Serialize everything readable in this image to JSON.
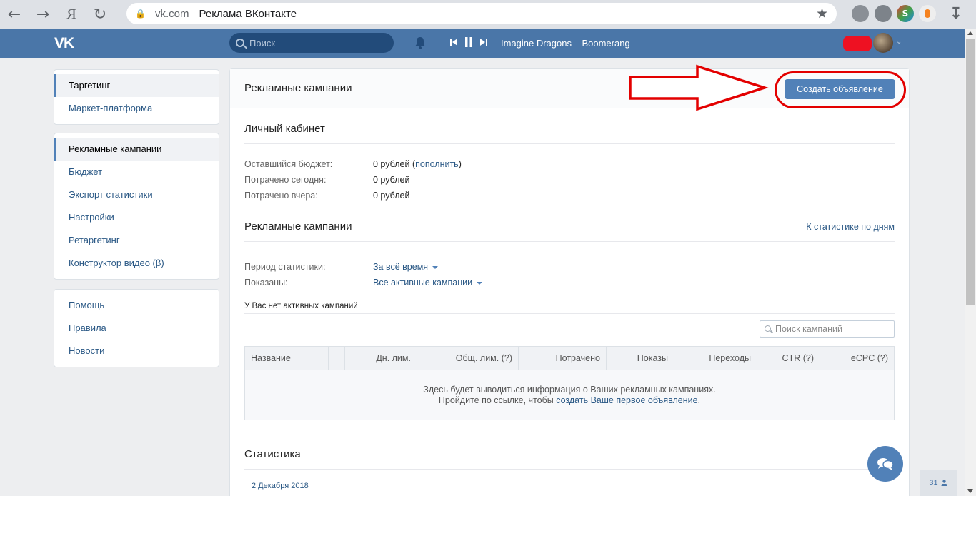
{
  "browser": {
    "url": "vk.com",
    "page_title": "Реклама ВКонтакте"
  },
  "vk": {
    "logo": "VK",
    "search_placeholder": "Поиск",
    "now_playing": "Imagine Dragons – Boomerang"
  },
  "sidebar": {
    "group1": [
      "Таргетинг",
      "Маркет-платформа"
    ],
    "group2": [
      "Рекламные кампании",
      "Бюджет",
      "Экспорт статистики",
      "Настройки",
      "Ретаргетинг",
      "Конструктор видео (β)"
    ],
    "group3": [
      "Помощь",
      "Правила",
      "Новости"
    ]
  },
  "main": {
    "header_title": "Рекламные кампании",
    "create_button": "Создать объявление",
    "cabinet_title": "Личный кабинет",
    "budget_label": "Оставшийся бюджет:",
    "budget_value": "0 рублей",
    "budget_paren_open": "(",
    "budget_link": "пополнить",
    "budget_paren_close": ")",
    "spent_today_label": "Потрачено сегодня:",
    "spent_today_value": "0 рублей",
    "spent_yesterday_label": "Потрачено вчера:",
    "spent_yesterday_value": "0 рублей",
    "campaigns_title": "Рекламные кампании",
    "stats_by_day_link": "К статистике по дням",
    "period_label": "Период статистики:",
    "period_value": "За всё время",
    "shown_label": "Показаны:",
    "shown_value": "Все активные кампании",
    "no_active_note": "У Вас нет активных кампаний",
    "search_placeholder": "Поиск кампаний",
    "table_headers": [
      "Название",
      "",
      "Дн. лим.",
      "Общ. лим. (?)",
      "Потрачено",
      "Показы",
      "Переходы",
      "CTR (?)",
      "eCPC (?)"
    ],
    "empty_line1": "Здесь будет выводиться информация о Ваших рекламных кампаниях.",
    "empty_line2_prefix": "Пройдите по ссылке, чтобы ",
    "empty_line2_link": "создать Ваше первое объявление",
    "empty_line2_suffix": ".",
    "statistics_title": "Статистика",
    "stat_date": "2 Декабря 2018"
  },
  "widgets": {
    "online_count": "31"
  },
  "colors": {
    "vk_blue": "#4a76a8",
    "button_blue": "#5181b8",
    "annotation_red": "#e30000"
  }
}
